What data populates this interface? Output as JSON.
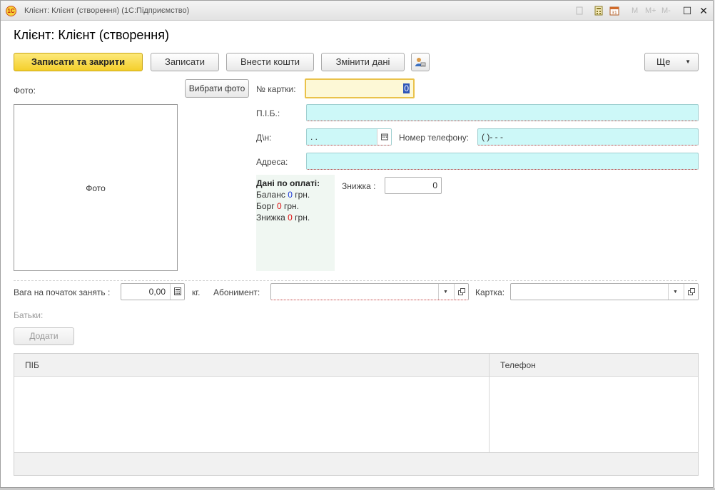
{
  "window": {
    "title": "Клієнт: Клієнт (створення)  (1С:Підприємство)",
    "logo_text": "1С",
    "tb_text_m": "M",
    "tb_text_mplus": "M+",
    "tb_text_mminus": "M-",
    "restore_symbol": "☐",
    "close_symbol": "✕"
  },
  "form": {
    "title": "Клієнт: Клієнт (створення)"
  },
  "toolbar": {
    "save_close_label": "Записати та закрити",
    "save_label": "Записати",
    "deposit_label": "Внести кошти",
    "change_data_label": "Змінити дані",
    "more_label": "Ще",
    "more_arrow": "▼"
  },
  "photo": {
    "label": "Фото:",
    "choose_button_label": "Вибрати фото",
    "placeholder": "Фото"
  },
  "fields": {
    "card_number_label": "№ картки:",
    "card_number_value": "0",
    "name_label": "П.І.Б.:",
    "name_value": "",
    "birthdate_label": "Д\\н:",
    "birthdate_value": " .  .",
    "phone_label": "Номер телефону:",
    "phone_value": "(   )-   -  -",
    "address_label": "Адреса:",
    "address_value": "",
    "discount_label": "Знижка :",
    "discount_value": "0"
  },
  "payment": {
    "heading": "Дані по оплаті:",
    "balance_prefix": "Баланс",
    "balance_value": "0",
    "debt_prefix": "Борг",
    "debt_value": "0",
    "discount_prefix": "Знижка",
    "discount_value": "0",
    "currency": "грн."
  },
  "lower": {
    "weight_label": "Вага на початок занять :",
    "weight_value": "0,00",
    "weight_unit": "кг.",
    "subscription_label": "Абонимент:",
    "subscription_value": "",
    "card_label": "Картка:",
    "card_value": "",
    "parents_label": "Батьки:",
    "add_button_label": "Додати"
  },
  "parents_table": {
    "columns": [
      "ПІБ",
      "Телефон"
    ],
    "rows": []
  },
  "icons": {
    "calendar": "calendar-icon",
    "calculator": "calculator-icon",
    "dropdown": "chevron-down-icon",
    "open": "open-form-icon",
    "user_card": "user-card-icon"
  }
}
